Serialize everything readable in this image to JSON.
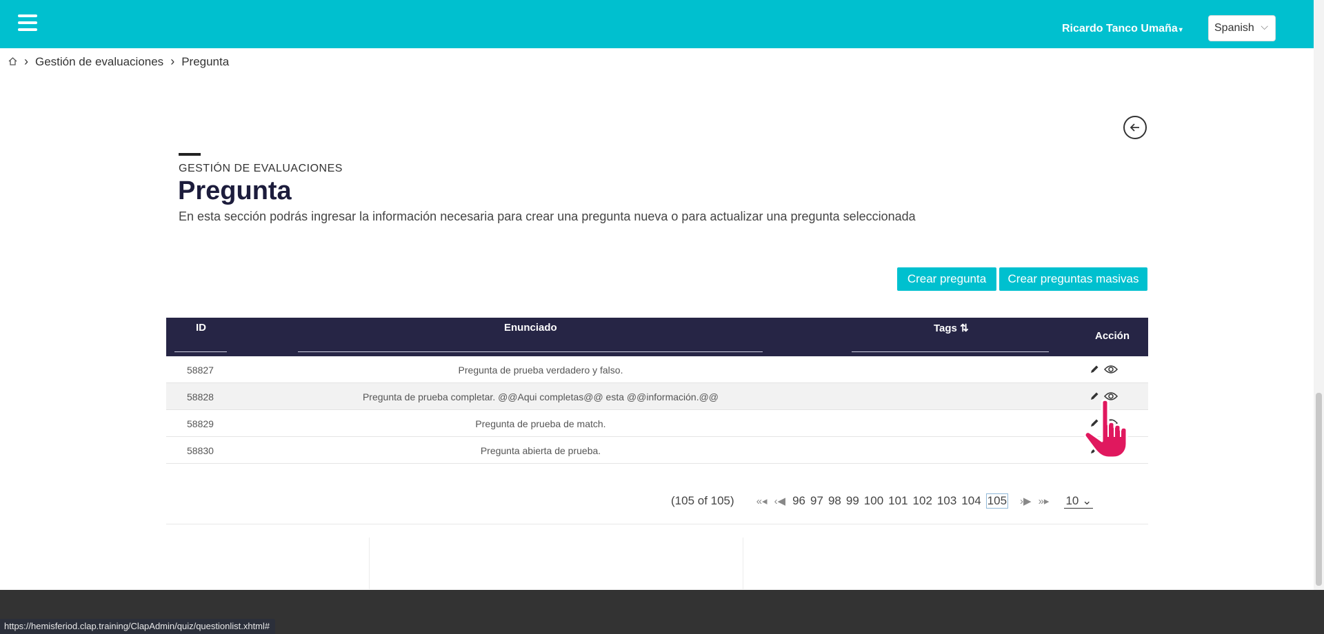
{
  "header": {
    "user_name": "Ricardo Tanco Umaña",
    "language": "Spanish"
  },
  "breadcrumb": {
    "items": [
      "Gestión de evaluaciones",
      "Pregunta"
    ]
  },
  "page": {
    "section_label": "GESTIÓN DE EVALUACIONES",
    "title": "Pregunta",
    "description": "En esta sección podrás ingresar la información necesaria para crear una pregunta nueva o para actualizar una pregunta seleccionada"
  },
  "actions": {
    "create": "Crear pregunta",
    "create_mass": "Crear preguntas masivas"
  },
  "table": {
    "headers": {
      "id": "ID",
      "enunciado": "Enunciado",
      "tags": "Tags ⇅",
      "accion": "Acción"
    },
    "rows": [
      {
        "id": "58827",
        "enunciado": "Pregunta de prueba verdadero y falso."
      },
      {
        "id": "58828",
        "enunciado": "Pregunta de prueba completar. @@Aqui completas@@ esta @@información.@@"
      },
      {
        "id": "58829",
        "enunciado": "Pregunta de prueba de match."
      },
      {
        "id": "58830",
        "enunciado": "Pregunta abierta de prueba."
      }
    ]
  },
  "pagination": {
    "report": "(105 of 105)",
    "pages": [
      "96",
      "97",
      "98",
      "99",
      "100",
      "101",
      "102",
      "103",
      "104",
      "105"
    ],
    "current_page": "105",
    "rows_per_page": "10"
  },
  "status_bar": {
    "url": "https://hemisferiod.clap.training/ClapAdmin/quiz/questionlist.xhtml#"
  },
  "colors": {
    "accent": "#00c0cf",
    "table_header": "#262545",
    "footer": "#333333"
  },
  "icons": [
    "menu-icon",
    "caret-down-icon",
    "home-icon",
    "chevron-right-icon",
    "arrow-left-icon",
    "sort-icon",
    "pencil-icon",
    "eye-icon",
    "first-page-icon",
    "prev-page-icon",
    "next-page-icon",
    "last-page-icon",
    "hand-pointer-icon"
  ]
}
